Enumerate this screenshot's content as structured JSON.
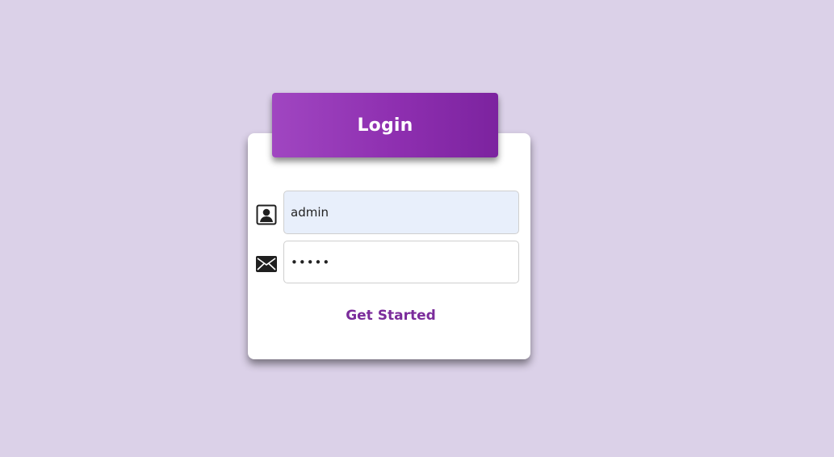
{
  "login_form": {
    "title": "Login",
    "username": {
      "value": "admin",
      "icon": "user-badge-icon"
    },
    "password": {
      "value": "•••••",
      "icon": "envelope-icon"
    },
    "submit_label": "Get Started"
  },
  "colors": {
    "background": "#dbd1e8",
    "card": "#ffffff",
    "header_gradient_start": "#a046c1",
    "header_gradient_end": "#7c239f",
    "accent_text": "#7b2c9b",
    "username_field_bg": "#e8effb"
  }
}
